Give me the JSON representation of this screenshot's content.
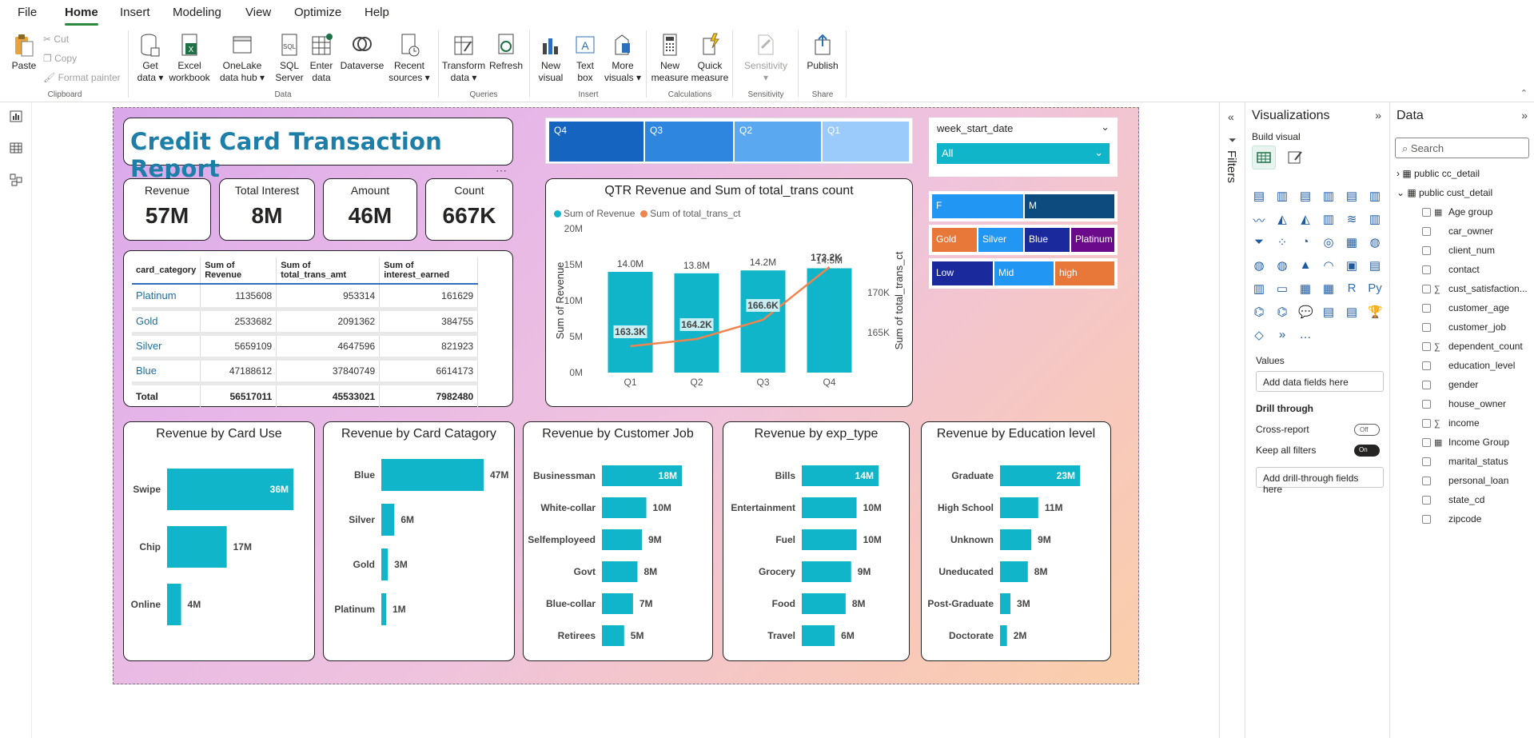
{
  "menu": [
    "File",
    "Home",
    "Insert",
    "Modeling",
    "View",
    "Optimize",
    "Help"
  ],
  "ribbon": {
    "clipboard": {
      "paste": "Paste",
      "cut": "Cut",
      "copy": "Copy",
      "format_painter": "Format painter",
      "group": "Clipboard"
    },
    "data": {
      "get_data": "Get data",
      "excel": "Excel workbook",
      "onelake": "OneLake data hub",
      "sql": "SQL Server",
      "enter_data": "Enter data",
      "dataverse": "Dataverse",
      "recent": "Recent sources",
      "group": "Data"
    },
    "queries": {
      "transform": "Transform data",
      "refresh": "Refresh",
      "group": "Queries"
    },
    "insert": {
      "new_visual": "New visual",
      "text_box": "Text box",
      "more_visuals": "More visuals",
      "group": "Insert"
    },
    "calculations": {
      "new_measure": "New measure",
      "quick_measure": "Quick measure",
      "group": "Calculations"
    },
    "sensitivity": {
      "sensitivity": "Sensitivity",
      "group": "Sensitivity"
    },
    "share": {
      "publish": "Publish",
      "group": "Share"
    }
  },
  "report": {
    "title": "Credit Card Transaction Report",
    "kpis": [
      {
        "label": "Revenue",
        "value": "57M"
      },
      {
        "label": "Total Interest",
        "value": "8M"
      },
      {
        "label": "Amount",
        "value": "46M"
      },
      {
        "label": "Count",
        "value": "667K"
      }
    ],
    "table": {
      "headers": [
        "card_category",
        "Sum of Revenue",
        "Sum of total_trans_amt",
        "Sum of interest_earned"
      ],
      "rows": [
        [
          "Platinum",
          "1135608",
          "953314",
          "161629"
        ],
        [
          "Gold",
          "2533682",
          "2091362",
          "384755"
        ],
        [
          "Silver",
          "5659109",
          "4647596",
          "821923"
        ],
        [
          "Blue",
          "47188612",
          "37840749",
          "6614173"
        ]
      ],
      "total": [
        "Total",
        "56517011",
        "45533021",
        "7982480"
      ]
    },
    "quarter_slicer": [
      "Q4",
      "Q3",
      "Q2",
      "Q1"
    ],
    "week_slicer": {
      "title": "week_start_date",
      "value": "All"
    },
    "gender_slicer": [
      "F",
      "M"
    ],
    "category_slicer": [
      "Gold",
      "Silver",
      "Blue",
      "Platinum"
    ],
    "income_slicer": [
      "Low",
      "Mid",
      "high"
    ]
  },
  "chart_data": [
    {
      "type": "bar+line",
      "title": "QTR Revenue and Sum of total_trans count",
      "categories": [
        "Q1",
        "Q2",
        "Q3",
        "Q4"
      ],
      "series": [
        {
          "name": "Sum of Revenue",
          "values": [
            14.0,
            13.8,
            14.2,
            14.5
          ],
          "labels": [
            "14.0M",
            "13.8M",
            "14.2M",
            "14.5M"
          ]
        },
        {
          "name": "Sum of total_trans_ct",
          "values": [
            163.3,
            164.2,
            166.6,
            173.2
          ],
          "labels": [
            "163.3K",
            "164.2K",
            "166.6K",
            "173.2K"
          ]
        }
      ],
      "ylabel": "Sum of Revenue",
      "y2label": "Sum of total_trans_ct",
      "yticks": [
        "0M",
        "5M",
        "10M",
        "15M",
        "20M"
      ],
      "ylim": [
        0,
        20
      ],
      "y2ticks": [
        "165K",
        "170K"
      ],
      "y2lim": [
        160,
        178
      ]
    },
    {
      "type": "bar",
      "title": "Revenue by Card Use",
      "categories": [
        "Swipe",
        "Chip",
        "Online"
      ],
      "values": [
        36,
        17,
        4
      ],
      "labels": [
        "36M",
        "17M",
        "4M"
      ]
    },
    {
      "type": "bar",
      "title": "Revenue by Card Catagory",
      "categories": [
        "Blue",
        "Silver",
        "Gold",
        "Platinum"
      ],
      "values": [
        47,
        6,
        3,
        1
      ],
      "labels": [
        "47M",
        "6M",
        "3M",
        "1M"
      ]
    },
    {
      "type": "bar",
      "title": "Revenue by Customer Job",
      "categories": [
        "Businessman",
        "White-collar",
        "Selfemployeed",
        "Govt",
        "Blue-collar",
        "Retirees"
      ],
      "values": [
        18,
        10,
        9,
        8,
        7,
        5
      ],
      "labels": [
        "18M",
        "10M",
        "9M",
        "8M",
        "7M",
        "5M"
      ]
    },
    {
      "type": "bar",
      "title": "Revenue by exp_type",
      "categories": [
        "Bills",
        "Entertainment",
        "Fuel",
        "Grocery",
        "Food",
        "Travel"
      ],
      "values": [
        14,
        10,
        10,
        9,
        8,
        6
      ],
      "labels": [
        "14M",
        "10M",
        "10M",
        "9M",
        "8M",
        "6M"
      ]
    },
    {
      "type": "bar",
      "title": "Revenue by Education level",
      "categories": [
        "Graduate",
        "High School",
        "Unknown",
        "Uneducated",
        "Post-Graduate",
        "Doctorate"
      ],
      "values": [
        23,
        11,
        9,
        8,
        3,
        2
      ],
      "labels": [
        "23M",
        "11M",
        "9M",
        "8M",
        "3M",
        "2M"
      ]
    }
  ],
  "filters_label": "Filters",
  "viz_pane": {
    "title": "Visualizations",
    "build_visual": "Build visual",
    "values": "Values",
    "add_data": "Add data fields here",
    "drill_through": "Drill through",
    "cross_report": "Cross-report",
    "cross_report_state": "Off",
    "keep_filters": "Keep all filters",
    "keep_filters_state": "On",
    "add_drill": "Add drill-through fields here"
  },
  "data_pane": {
    "title": "Data",
    "search_placeholder": "Search",
    "tables": [
      "public cc_detail",
      "public cust_detail"
    ],
    "fields": [
      "Age group",
      "car_owner",
      "client_num",
      "contact",
      "cust_satisfaction...",
      "customer_age",
      "customer_job",
      "dependent_count",
      "education_level",
      "gender",
      "house_owner",
      "income",
      "Income Group",
      "marital_status",
      "personal_loan",
      "state_cd",
      "zipcode"
    ]
  },
  "colors": {
    "accent": "#11b5c9",
    "title": "#1d7ea8",
    "line": "#f0844f",
    "pbi_yellow": "#f2c811"
  }
}
